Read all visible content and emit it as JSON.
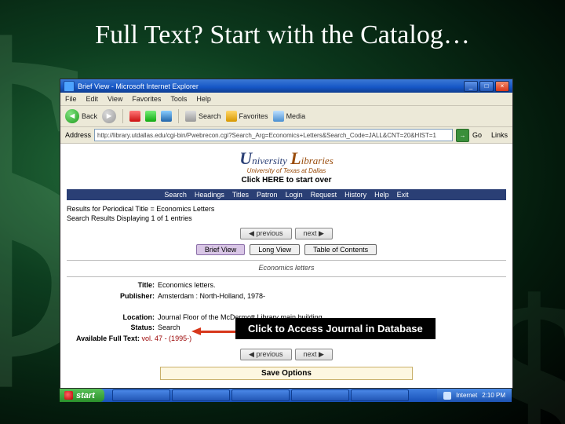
{
  "slide": {
    "title": "Full Text? Start with the Catalog…",
    "callout": "Click to Access Journal in Database"
  },
  "window": {
    "title": "Brief View - Microsoft Internet Explorer",
    "min": "_",
    "max": "□",
    "close": "×"
  },
  "menu": {
    "file": "File",
    "edit": "Edit",
    "view": "View",
    "fav": "Favorites",
    "tools": "Tools",
    "help": "Help"
  },
  "toolbar": {
    "back": "Back",
    "search": "Search",
    "favorites": "Favorites",
    "media": "Media"
  },
  "address": {
    "label": "Address",
    "url": "http://library.utdallas.edu/cgi-bin/Pwebrecon.cgi?Search_Arg=Economics+Letters&Search_Code=JALL&CNT=20&HIST=1",
    "go": "Go",
    "links": "Links"
  },
  "library": {
    "logo_u": "U",
    "logo_rest": "niversity",
    "logo_l": "L",
    "logo_rest2": "ibraries",
    "logo_sub": "University of Texas at Dallas",
    "start_over": "Click HERE to start over"
  },
  "nav": {
    "search": "Search",
    "headings": "Headings",
    "titles": "Titles",
    "patron": "Patron",
    "login": "Login",
    "request": "Request",
    "history": "History",
    "help": "Help",
    "exit": "Exit"
  },
  "results": {
    "line1": "Results for Periodical Title = Economics Letters",
    "line2": "Search Results Displaying 1 of 1 entries"
  },
  "pager": {
    "prev": "◀ previous",
    "next": "next ▶"
  },
  "tabs": {
    "brief": "Brief View",
    "long": "Long View",
    "toc": "Table of Contents"
  },
  "journal_title": "Economics letters",
  "record": {
    "title_lbl": "Title:",
    "title_val": "Economics letters.",
    "pub_lbl": "Publisher:",
    "pub_val": "Amsterdam : North-Holland, 1978-",
    "loc_lbl": "Location:",
    "loc_val": "Journal Floor of the McDermott Library main building.",
    "status_lbl": "Status:",
    "status_val": "Search",
    "ft_lbl": "Available Full Text:",
    "ft_link": "vol. 47 - (1995-)"
  },
  "save": "Save Options",
  "taskbar": {
    "start": "start",
    "time": "2:10 PM",
    "internet": "Internet"
  }
}
